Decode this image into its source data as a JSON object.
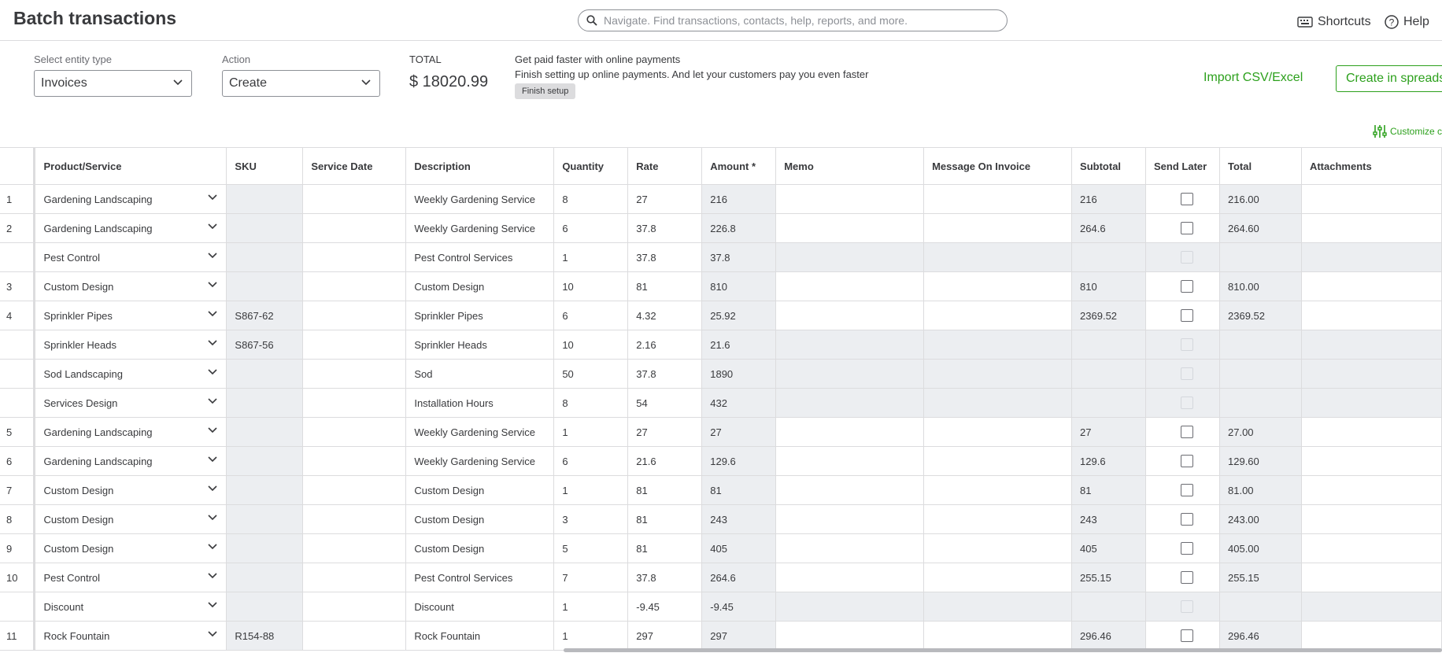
{
  "page_title": "Batch transactions",
  "search": {
    "placeholder": "Navigate. Find transactions, contacts, help, reports, and more."
  },
  "header_links": {
    "shortcuts": "Shortcuts",
    "help": "Help"
  },
  "toolbar": {
    "entity_label": "Select entity type",
    "entity_value": "Invoices",
    "action_label": "Action",
    "action_value": "Create",
    "total_label": "TOTAL",
    "total_value": "$ 18020.99",
    "promo_title": "Get paid faster with online payments",
    "promo_text": "Finish setting up online payments. And let your customers pay you even faster",
    "finish_setup": "Finish setup",
    "import_link": "Import CSV/Excel",
    "create_button": "Create in spreadsheet",
    "customize": "Customize columns"
  },
  "columns": [
    "Product/Service",
    "SKU",
    "Service Date",
    "Description",
    "Quantity",
    "Rate",
    "Amount *",
    "Memo",
    "Message On Invoice",
    "Subtotal",
    "Send Later",
    "Total",
    "Attachments"
  ],
  "rows": [
    {
      "num": "1",
      "product": "Gardening Landscaping",
      "sku": "",
      "date": "",
      "desc": "Weekly Gardening Service",
      "qty": "8",
      "rate": "27",
      "amount": "216",
      "memo": "",
      "msg": "",
      "subtotal": "216",
      "send": "box",
      "total": "216.00",
      "attach": ""
    },
    {
      "num": "2",
      "product": "Gardening Landscaping",
      "sku": "",
      "date": "",
      "desc": "Weekly Gardening Service",
      "qty": "6",
      "rate": "37.8",
      "amount": "226.8",
      "memo": "",
      "msg": "",
      "subtotal": "264.6",
      "send": "box",
      "total": "264.60",
      "attach": ""
    },
    {
      "num": "",
      "product": "Pest Control",
      "sku": "",
      "date": "",
      "desc": "Pest Control Services",
      "qty": "1",
      "rate": "37.8",
      "amount": "37.8",
      "memo": "",
      "msg": "",
      "subtotal": "",
      "send": "disabled",
      "total": "",
      "attach": ""
    },
    {
      "num": "3",
      "product": "Custom Design",
      "sku": "",
      "date": "",
      "desc": "Custom Design",
      "qty": "10",
      "rate": "81",
      "amount": "810",
      "memo": "",
      "msg": "",
      "subtotal": "810",
      "send": "box",
      "total": "810.00",
      "attach": ""
    },
    {
      "num": "4",
      "product": "Sprinkler Pipes",
      "sku": "S867-62",
      "date": "",
      "desc": "Sprinkler Pipes",
      "qty": "6",
      "rate": "4.32",
      "amount": "25.92",
      "memo": "",
      "msg": "",
      "subtotal": "2369.52",
      "send": "box",
      "total": "2369.52",
      "attach": ""
    },
    {
      "num": "",
      "product": "Sprinkler Heads",
      "sku": "S867-56",
      "date": "",
      "desc": "Sprinkler Heads",
      "qty": "10",
      "rate": "2.16",
      "amount": "21.6",
      "memo": "",
      "msg": "",
      "subtotal": "",
      "send": "disabled",
      "total": "",
      "attach": ""
    },
    {
      "num": "",
      "product": "Sod Landscaping",
      "sku": "",
      "date": "",
      "desc": "Sod",
      "qty": "50",
      "rate": "37.8",
      "amount": "1890",
      "memo": "",
      "msg": "",
      "subtotal": "",
      "send": "disabled",
      "total": "",
      "attach": ""
    },
    {
      "num": "",
      "product": "Services Design",
      "sku": "",
      "date": "",
      "desc": "Installation Hours",
      "qty": "8",
      "rate": "54",
      "amount": "432",
      "memo": "",
      "msg": "",
      "subtotal": "",
      "send": "disabled",
      "total": "",
      "attach": ""
    },
    {
      "num": "5",
      "product": "Gardening Landscaping",
      "sku": "",
      "date": "",
      "desc": "Weekly Gardening Service",
      "qty": "1",
      "rate": "27",
      "amount": "27",
      "memo": "",
      "msg": "",
      "subtotal": "27",
      "send": "box",
      "total": "27.00",
      "attach": ""
    },
    {
      "num": "6",
      "product": "Gardening Landscaping",
      "sku": "",
      "date": "",
      "desc": "Weekly Gardening Service",
      "qty": "6",
      "rate": "21.6",
      "amount": "129.6",
      "memo": "",
      "msg": "",
      "subtotal": "129.6",
      "send": "box",
      "total": "129.60",
      "attach": ""
    },
    {
      "num": "7",
      "product": "Custom Design",
      "sku": "",
      "date": "",
      "desc": "Custom Design",
      "qty": "1",
      "rate": "81",
      "amount": "81",
      "memo": "",
      "msg": "",
      "subtotal": "81",
      "send": "box",
      "total": "81.00",
      "attach": ""
    },
    {
      "num": "8",
      "product": "Custom Design",
      "sku": "",
      "date": "",
      "desc": "Custom Design",
      "qty": "3",
      "rate": "81",
      "amount": "243",
      "memo": "",
      "msg": "",
      "subtotal": "243",
      "send": "box",
      "total": "243.00",
      "attach": ""
    },
    {
      "num": "9",
      "product": "Custom Design",
      "sku": "",
      "date": "",
      "desc": "Custom Design",
      "qty": "5",
      "rate": "81",
      "amount": "405",
      "memo": "",
      "msg": "",
      "subtotal": "405",
      "send": "box",
      "total": "405.00",
      "attach": ""
    },
    {
      "num": "10",
      "product": "Pest Control",
      "sku": "",
      "date": "",
      "desc": "Pest Control Services",
      "qty": "7",
      "rate": "37.8",
      "amount": "264.6",
      "memo": "",
      "msg": "",
      "subtotal": "255.15",
      "send": "box",
      "total": "255.15",
      "attach": ""
    },
    {
      "num": "",
      "product": "Discount",
      "sku": "",
      "date": "",
      "desc": "Discount",
      "qty": "1",
      "rate": "-9.45",
      "amount": "-9.45",
      "memo": "",
      "msg": "",
      "subtotal": "",
      "send": "disabled",
      "total": "",
      "attach": ""
    },
    {
      "num": "11",
      "product": "Rock Fountain",
      "sku": "R154-88",
      "date": "",
      "desc": "Rock Fountain",
      "qty": "1",
      "rate": "297",
      "amount": "297",
      "memo": "",
      "msg": "",
      "subtotal": "296.46",
      "send": "box",
      "total": "296.46",
      "attach": ""
    }
  ],
  "colors": {
    "accent": "#2ca01c",
    "readonly_bg": "#eceef1",
    "border": "#dcdcde"
  }
}
